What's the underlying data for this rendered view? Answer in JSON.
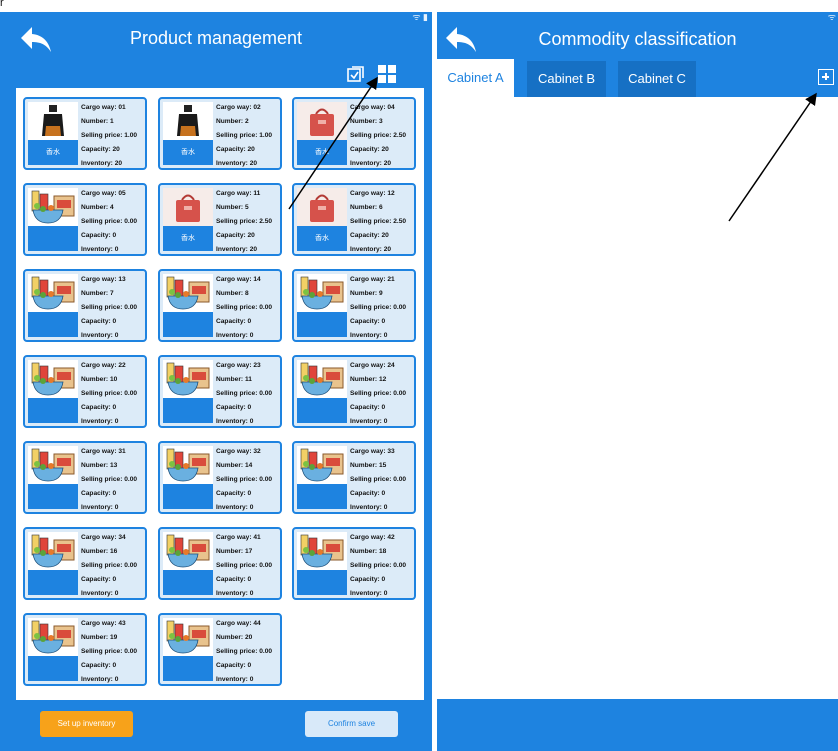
{
  "top_strip_text": "r",
  "left": {
    "status_icons": "ᯤ ▮",
    "title": "Product management",
    "bottom": {
      "set_inventory": "Set up inventory",
      "confirm_save": "Confirm save"
    },
    "cards": [
      {
        "cargo": "Cargo way: 01",
        "number": "Number: 1",
        "price": "Selling price: 1.00",
        "capacity": "Capacity: 20",
        "inventory": "Inventory: 20",
        "tag": "香水",
        "image": "perfume-bottle"
      },
      {
        "cargo": "Cargo way: 02",
        "number": "Number: 2",
        "price": "Selling price: 1.00",
        "capacity": "Capacity: 20",
        "inventory": "Inventory: 20",
        "tag": "香水",
        "image": "perfume-bottle"
      },
      {
        "cargo": "Cargo way: 04",
        "number": "Number: 3",
        "price": "Selling price: 2.50",
        "capacity": "Capacity: 20",
        "inventory": "Inventory: 20",
        "tag": "香水",
        "image": "red-bag"
      },
      {
        "cargo": "Cargo way: 05",
        "number": "Number: 4",
        "price": "Selling price: 0.00",
        "capacity": "Capacity: 0",
        "inventory": "Inventory: 0",
        "tag": "",
        "image": "groceries"
      },
      {
        "cargo": "Cargo way: 11",
        "number": "Number: 5",
        "price": "Selling price: 2.50",
        "capacity": "Capacity: 20",
        "inventory": "Inventory: 20",
        "tag": "香水",
        "image": "red-bag"
      },
      {
        "cargo": "Cargo way: 12",
        "number": "Number: 6",
        "price": "Selling price: 2.50",
        "capacity": "Capacity: 20",
        "inventory": "Inventory: 20",
        "tag": "香水",
        "image": "red-bag"
      },
      {
        "cargo": "Cargo way: 13",
        "number": "Number: 7",
        "price": "Selling price: 0.00",
        "capacity": "Capacity: 0",
        "inventory": "Inventory: 0",
        "tag": "",
        "image": "groceries"
      },
      {
        "cargo": "Cargo way: 14",
        "number": "Number: 8",
        "price": "Selling price: 0.00",
        "capacity": "Capacity: 0",
        "inventory": "Inventory: 0",
        "tag": "",
        "image": "groceries"
      },
      {
        "cargo": "Cargo way: 21",
        "number": "Number: 9",
        "price": "Selling price: 0.00",
        "capacity": "Capacity: 0",
        "inventory": "Inventory: 0",
        "tag": "",
        "image": "groceries"
      },
      {
        "cargo": "Cargo way: 22",
        "number": "Number: 10",
        "price": "Selling price: 0.00",
        "capacity": "Capacity: 0",
        "inventory": "Inventory: 0",
        "tag": "",
        "image": "groceries"
      },
      {
        "cargo": "Cargo way: 23",
        "number": "Number: 11",
        "price": "Selling price: 0.00",
        "capacity": "Capacity: 0",
        "inventory": "Inventory: 0",
        "tag": "",
        "image": "groceries"
      },
      {
        "cargo": "Cargo way: 24",
        "number": "Number: 12",
        "price": "Selling price: 0.00",
        "capacity": "Capacity: 0",
        "inventory": "Inventory: 0",
        "tag": "",
        "image": "groceries"
      },
      {
        "cargo": "Cargo way: 31",
        "number": "Number: 13",
        "price": "Selling price: 0.00",
        "capacity": "Capacity: 0",
        "inventory": "Inventory: 0",
        "tag": "",
        "image": "groceries"
      },
      {
        "cargo": "Cargo way: 32",
        "number": "Number: 14",
        "price": "Selling price: 0.00",
        "capacity": "Capacity: 0",
        "inventory": "Inventory: 0",
        "tag": "",
        "image": "groceries"
      },
      {
        "cargo": "Cargo way: 33",
        "number": "Number: 15",
        "price": "Selling price: 0.00",
        "capacity": "Capacity: 0",
        "inventory": "Inventory: 0",
        "tag": "",
        "image": "groceries"
      },
      {
        "cargo": "Cargo way: 34",
        "number": "Number: 16",
        "price": "Selling price: 0.00",
        "capacity": "Capacity: 0",
        "inventory": "Inventory: 0",
        "tag": "",
        "image": "groceries"
      },
      {
        "cargo": "Cargo way: 41",
        "number": "Number: 17",
        "price": "Selling price: 0.00",
        "capacity": "Capacity: 0",
        "inventory": "Inventory: 0",
        "tag": "",
        "image": "groceries"
      },
      {
        "cargo": "Cargo way: 42",
        "number": "Number: 18",
        "price": "Selling price: 0.00",
        "capacity": "Capacity: 0",
        "inventory": "Inventory: 0",
        "tag": "",
        "image": "groceries"
      },
      {
        "cargo": "Cargo way: 43",
        "number": "Number: 19",
        "price": "Selling price: 0.00",
        "capacity": "Capacity: 0",
        "inventory": "Inventory: 0",
        "tag": "",
        "image": "groceries"
      },
      {
        "cargo": "Cargo way: 44",
        "number": "Number: 20",
        "price": "Selling price: 0.00",
        "capacity": "Capacity: 0",
        "inventory": "Inventory: 0",
        "tag": "",
        "image": "groceries"
      }
    ]
  },
  "right": {
    "status_icons": "ᯤ",
    "title": "Commodity classification",
    "tabs": [
      {
        "label": "Cabinet A",
        "active": true
      },
      {
        "label": "Cabinet B",
        "active": false
      },
      {
        "label": "Cabinet C",
        "active": false
      }
    ]
  },
  "colors": {
    "primary": "#1e83e0",
    "card_bg": "#dcebf8",
    "accent_orange": "#f7a21a",
    "tab_dark": "#1670c4"
  }
}
